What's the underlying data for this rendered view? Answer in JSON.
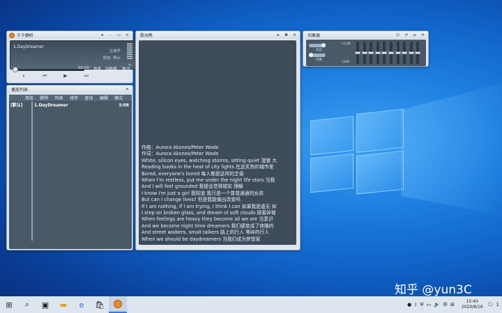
{
  "player": {
    "title": "千千静听",
    "track": "1.DayDreamer",
    "status1": "立体声",
    "status2": "状态: 停止",
    "time": "00:00",
    "playlist_btn": "列表",
    "eq_btn": "均衡器",
    "lyrics_btn": "歌词",
    "controls": [
      "⏸",
      "⏮",
      "▶",
      "⏭"
    ]
  },
  "playlist": {
    "title": "播放列表",
    "menu": [
      "添加",
      "删除",
      "列表",
      "排序",
      "查找",
      "编辑",
      "模式"
    ],
    "group": "[默认]",
    "items": [
      {
        "name": "1.DayDreamer",
        "duration": "3:08"
      }
    ]
  },
  "lyrics": {
    "title": "歌词秀",
    "lines": [
      "作曲：Aurora Aksnes/Peter Wade",
      "作词：Aurora Aksnes/Peter Wade",
      "White, silicon eyes, watching storms, sitting quiet    澄澈 大",
      "Reading books in the heat of city lights     在这炙热的城市里",
      "Bored, everyone's bored     每人都是这样的乏倦",
      "When I'm restless, put me under the night life stars     当我",
      "And I will feel grounded     我便会觉得踏实 理解",
      "I know I'm just a girl     我知道 我只是一个普普通通的女孩",
      "But can I change lives?     但是我能做出改变吗",
      "If I am nothing, if I am trying, I think I can     如果我是虚无 如",
      "I step on broken glass, and dream of soft clouds     踩着碎玻",
      "When feelings are heavy they become all we are     当意识",
      "And we become night time dreamers     我们便变成了夜晚的",
      "And street walkers, small talkers     路上的行人 零碎的行人",
      "When we should be daydreamers     当我们成为梦想家"
    ]
  },
  "equalizer": {
    "title": "均衡器",
    "label_on": "开启",
    "label_profile": "均衡",
    "scale_top": "+12dB",
    "scale_bottom": "-12dB",
    "bands": [
      0.5,
      0.5,
      0.5,
      0.5,
      0.5,
      0.5,
      0.5,
      0.5,
      0.5,
      0.5
    ]
  },
  "taskbar": {
    "time": "15:40",
    "date": "2020/8/16",
    "ime": "中",
    "notification_count": "1"
  },
  "watermark": "知乎 @yun3C"
}
